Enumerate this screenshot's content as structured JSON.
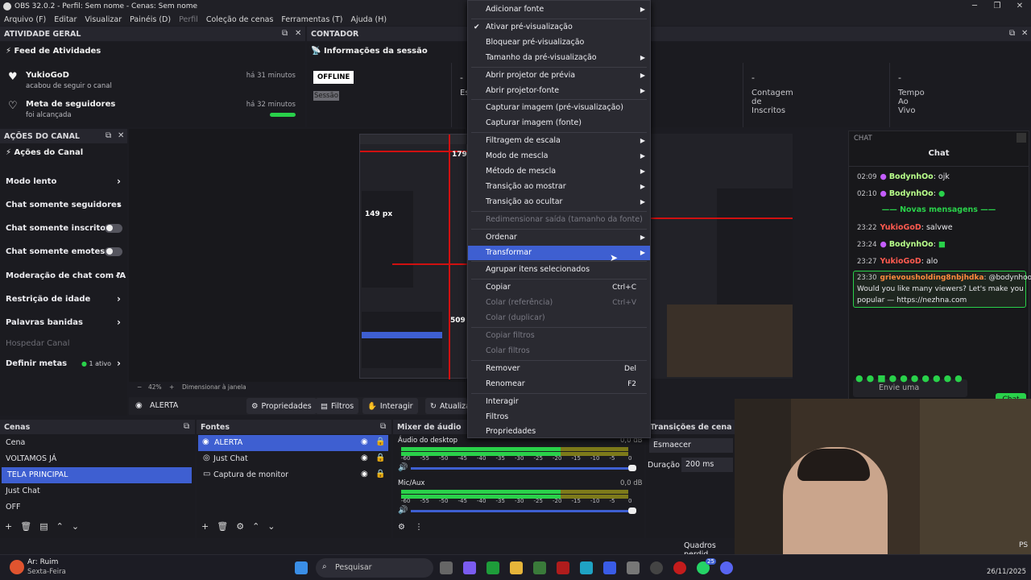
{
  "window": {
    "title": "OBS 32.0.2 - Perfil: Sem nome - Cenas: Sem nome"
  },
  "menu": [
    "Arquivo (F)",
    "Editar",
    "Visualizar",
    "Painéis (D)",
    "Perfil",
    "Coleção de cenas",
    "Ferramentas (T)",
    "Ajuda (H)"
  ],
  "activity": {
    "dock_title": "ATIVIDADE GERAL",
    "header": "Feed de Atividades",
    "items": [
      {
        "name": "YukioGoD",
        "sub": "acabou de seguir o canal",
        "time": "há 31 minutos"
      },
      {
        "name": "Meta de seguidores",
        "sub": "foi alcançada",
        "time": "há 32 minutos"
      }
    ]
  },
  "counter": {
    "dock_title": "CONTADOR",
    "header": "Informações da sessão",
    "status": "OFFLINE",
    "session": "Sessão",
    "stats": [
      {
        "value": "-",
        "label": "Es"
      },
      {
        "value": "-",
        "label": "Contagem de Inscritos"
      },
      {
        "value": "-",
        "label": "Tempo Ao Vivo"
      }
    ]
  },
  "actions": {
    "dock_title": "AÇÕES DO CANAL",
    "header": "Ações do Canal",
    "items": [
      {
        "label": "Modo lento",
        "kind": "chevron"
      },
      {
        "label": "Chat somente seguidores",
        "kind": "chevron"
      },
      {
        "label": "Chat somente inscritos",
        "kind": "toggle"
      },
      {
        "label": "Chat somente emotes",
        "kind": "toggle"
      },
      {
        "label": "Moderação de chat com IA",
        "kind": "external"
      },
      {
        "label": "Restrição de idade",
        "kind": "chevron"
      },
      {
        "label": "Palavras banidas",
        "kind": "chevron"
      },
      {
        "label": "Hospedar Canal",
        "kind": "disabled"
      },
      {
        "label": "Definir metas",
        "kind": "chevron",
        "badge": "1 ativo"
      }
    ]
  },
  "preview": {
    "zoom": "42%",
    "resize": "Dimensionar à janela",
    "overlay_1": "179",
    "overlay_2": "149 px",
    "overlay_3": "509"
  },
  "source_toolbar": {
    "source": "ALERTA",
    "properties": "Propriedades",
    "filters": "Filtros",
    "interact": "Interagir",
    "update": "Atualizar"
  },
  "context_menu": {
    "items": [
      {
        "label": "Adicionar fonte",
        "sub": true
      },
      {
        "sep": true
      },
      {
        "label": "Ativar pré-visualização",
        "checked": true
      },
      {
        "label": "Bloquear pré-visualização"
      },
      {
        "label": "Tamanho da pré-visualização",
        "sub": true
      },
      {
        "sep": true
      },
      {
        "label": "Abrir projetor de prévia",
        "sub": true
      },
      {
        "label": "Abrir projetor-fonte",
        "sub": true
      },
      {
        "sep": true
      },
      {
        "label": "Capturar imagem (pré-visualização)"
      },
      {
        "label": "Capturar imagem (fonte)"
      },
      {
        "sep": true
      },
      {
        "label": "Filtragem de escala",
        "sub": true
      },
      {
        "label": "Modo de mescla",
        "sub": true
      },
      {
        "label": "Método de mescla",
        "sub": true
      },
      {
        "label": "Transição ao mostrar",
        "sub": true
      },
      {
        "label": "Transição ao ocultar",
        "sub": true
      },
      {
        "sep": true
      },
      {
        "label": "Redimensionar saída (tamanho da fonte)",
        "disabled": true
      },
      {
        "sep": true
      },
      {
        "label": "Ordenar",
        "sub": true
      },
      {
        "label": "Transformar",
        "sub": true,
        "highlight": true
      },
      {
        "sep": true
      },
      {
        "label": "Agrupar itens selecionados"
      },
      {
        "sep": true
      },
      {
        "label": "Copiar",
        "shortcut": "Ctrl+C"
      },
      {
        "label": "Colar (referência)",
        "shortcut": "Ctrl+V",
        "disabled": true
      },
      {
        "label": "Colar (duplicar)",
        "disabled": true
      },
      {
        "sep": true
      },
      {
        "label": "Copiar filtros",
        "disabled": true
      },
      {
        "label": "Colar filtros",
        "disabled": true
      },
      {
        "sep": true
      },
      {
        "label": "Remover",
        "shortcut": "Del"
      },
      {
        "label": "Renomear",
        "shortcut": "F2"
      },
      {
        "sep": true
      },
      {
        "label": "Interagir"
      },
      {
        "label": "Filtros"
      },
      {
        "label": "Propriedades"
      }
    ]
  },
  "chat": {
    "dock_title": "CHAT",
    "header": "Chat",
    "new_messages": "Novas mensagens",
    "messages": [
      {
        "time": "02:09",
        "user": "BodynhOo",
        "text": ": ojk",
        "color": "green"
      },
      {
        "time": "02:10",
        "user": "BodynhOo",
        "text": ":",
        "color": "green"
      },
      {
        "time": "23:22",
        "user": "YukioGoD",
        "text": ": salvwe",
        "color": "red"
      },
      {
        "time": "23:24",
        "user": "BodynhOo",
        "text": ":",
        "color": "green"
      },
      {
        "time": "23:27",
        "user": "YukioGoD",
        "text": ": alo",
        "color": "red"
      }
    ],
    "highlight": {
      "time": "23:30",
      "user": "grievousholding8nbjhdka",
      "line1": ": @bodynhoo",
      "line2": "Would you like many viewers? Let's make you",
      "line3": "popular — https://nezhna.com"
    },
    "input_placeholder": "Envie uma",
    "send": "Chat"
  },
  "scenes": {
    "title": "Cenas",
    "items": [
      "Cena",
      "VOLTAMOS JÁ",
      "TELA PRINCIPAL",
      "Just Chat",
      "OFF"
    ],
    "selected": 2
  },
  "sources": {
    "title": "Fontes",
    "items": [
      "ALERTA",
      "Just Chat",
      "Captura de monitor"
    ],
    "selected": 0
  },
  "mixer": {
    "title": "Mixer de áudio",
    "channels": [
      {
        "name": "Áudio do desktop",
        "db": "0,0 dB"
      },
      {
        "name": "Mic/Aux",
        "db": "0,0 dB"
      }
    ],
    "ticks": [
      "-60",
      "-55",
      "-50",
      "-45",
      "-40",
      "-35",
      "-30",
      "-25",
      "-20",
      "-15",
      "-10",
      "-5",
      "0"
    ]
  },
  "transitions": {
    "title": "Transições de cena",
    "selected": "Esmaecer",
    "duration_label": "Duração",
    "duration": "200 ms"
  },
  "status": {
    "dropped": "Quadros perdid",
    "ps": "PS"
  },
  "taskbar": {
    "weather": "Ar: Ruim",
    "day": "Sexta-Feira",
    "search": "Pesquisar",
    "date": "26/11/2025",
    "badge": "25"
  },
  "colors": {
    "accent": "#3e5fd1",
    "bg": "#1c1c22",
    "green": "#29d14a",
    "chat_green": "#b8ff8a",
    "chat_red": "#ff5a4f"
  }
}
